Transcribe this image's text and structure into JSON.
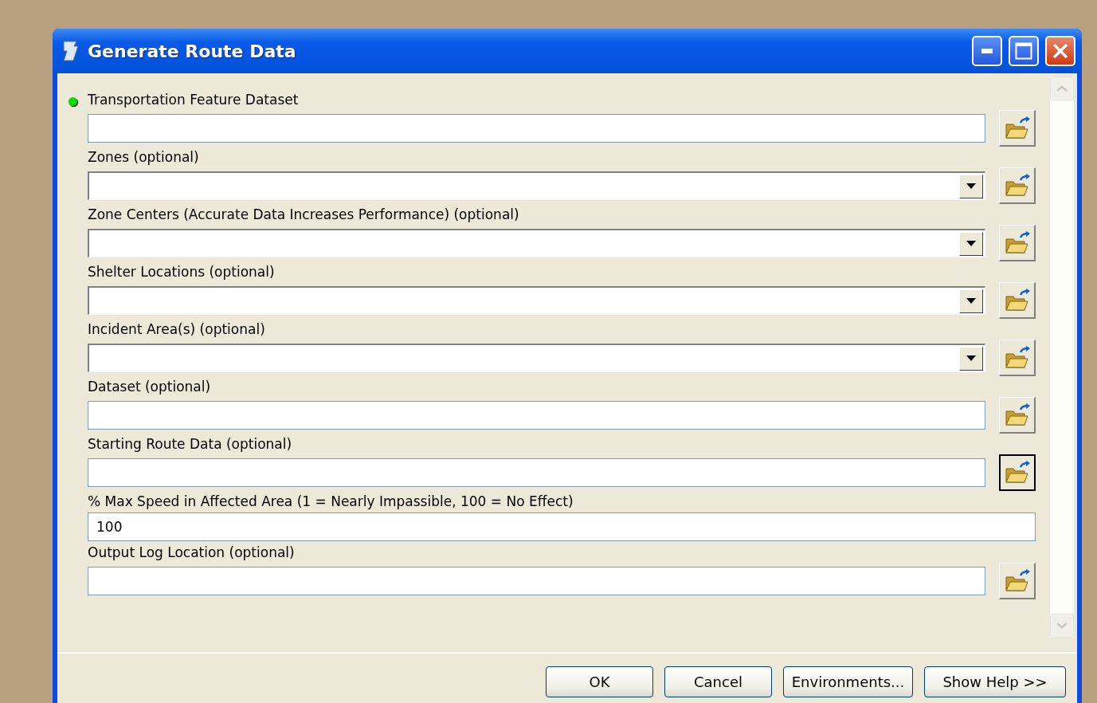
{
  "window": {
    "title": "Generate Route Data"
  },
  "fields": [
    {
      "label": "Transportation Feature Dataset",
      "kind": "text",
      "required": true,
      "browse_focused": false
    },
    {
      "label": "Zones (optional)",
      "kind": "combo",
      "required": false,
      "browse_focused": false
    },
    {
      "label": "Zone Centers (Accurate Data Increases Performance) (optional)",
      "kind": "combo",
      "required": false,
      "browse_focused": false
    },
    {
      "label": "Shelter Locations (optional)",
      "kind": "combo",
      "required": false,
      "browse_focused": false
    },
    {
      "label": "Incident Area(s) (optional)",
      "kind": "combo",
      "required": false,
      "browse_focused": false
    },
    {
      "label": "Dataset (optional)",
      "kind": "text",
      "required": false,
      "browse_focused": false
    },
    {
      "label": "Starting Route Data (optional)",
      "kind": "text",
      "required": false,
      "browse_focused": true
    },
    {
      "label": "% Max Speed in Affected Area (1 = Nearly Impassible, 100 = No Effect)",
      "kind": "number",
      "required": false,
      "value": "100"
    },
    {
      "label": "Output Log Location (optional)",
      "kind": "text",
      "required": false,
      "browse_focused": false
    }
  ],
  "buttons": [
    "OK",
    "Cancel",
    "Environments...",
    "Show Help >>"
  ]
}
